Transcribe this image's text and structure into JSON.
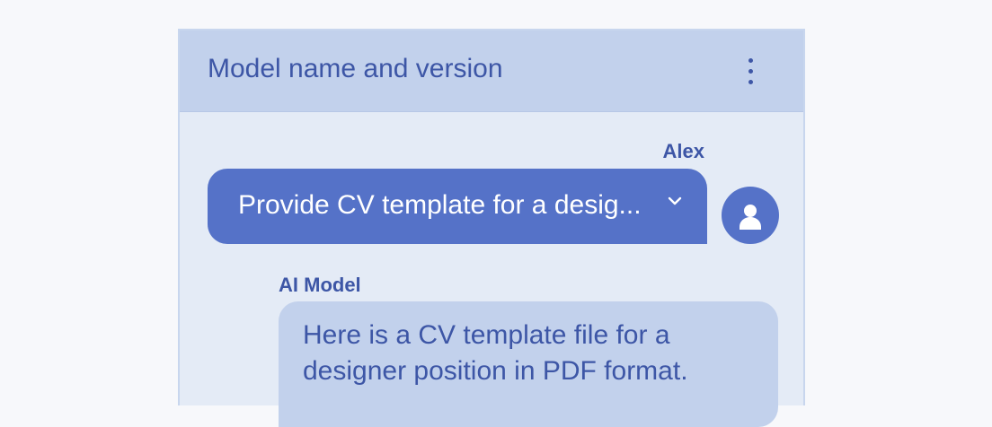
{
  "header": {
    "title": "Model name and version",
    "more_icon": "more-vert-icon"
  },
  "messages": [
    {
      "sender": "Alex",
      "text": "Provide CV template for a desig...",
      "expand_icon": "chevron-down-icon",
      "avatar_icon": "person-icon"
    },
    {
      "sender": "AI Model",
      "text": "Here is a CV template file for a designer position in PDF format."
    }
  ],
  "colors": {
    "page_background": "#f7f8fb",
    "panel_background": "#e4ebf6",
    "header_background": "#c2d1ec",
    "accent": "#5572c8",
    "text_primary": "#3d56a6"
  }
}
